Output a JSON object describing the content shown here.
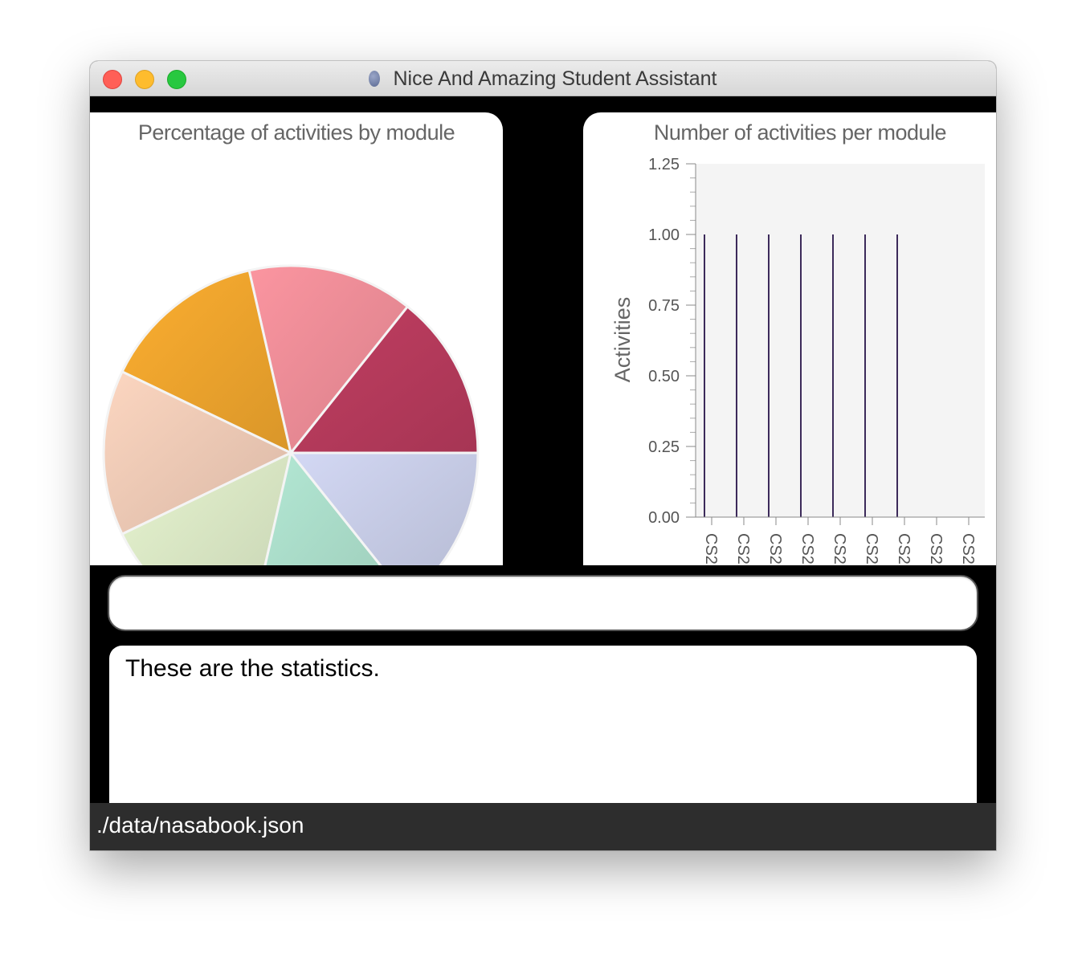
{
  "window": {
    "title": "Nice And Amazing Student Assistant",
    "app_icon": "nasa-logo-icon"
  },
  "pie_chart": {
    "title": "Percentage of activities by module",
    "chart_data": {
      "type": "pie",
      "values": [
        1,
        1,
        1,
        1,
        1,
        1,
        1
      ],
      "colors": [
        "#b3395a",
        "#e88a94",
        "#e9a12c",
        "#e9c6b2",
        "#d5e2c0",
        "#a7d8c5",
        "#c3c8e2"
      ]
    }
  },
  "bar_chart": {
    "title": "Number of activities per module",
    "chart_data": {
      "type": "bar",
      "categories": [
        "CS2",
        "CS2",
        "CS2",
        "CS2",
        "CS2",
        "CS2",
        "CS2",
        "CS2",
        "CS2"
      ],
      "values": [
        1,
        1,
        1,
        1,
        1,
        1,
        1,
        0,
        0
      ],
      "ylabel": "Activities",
      "ylim": [
        0,
        1.25
      ],
      "yticks": [
        "0.00",
        "0.25",
        "0.50",
        "0.75",
        "1.00",
        "1.25"
      ],
      "bar_color": "#3c2a5a"
    }
  },
  "command": {
    "value": "",
    "placeholder": ""
  },
  "result": {
    "text": "These are the statistics."
  },
  "status": {
    "file_path": "./data/nasabook.json"
  }
}
